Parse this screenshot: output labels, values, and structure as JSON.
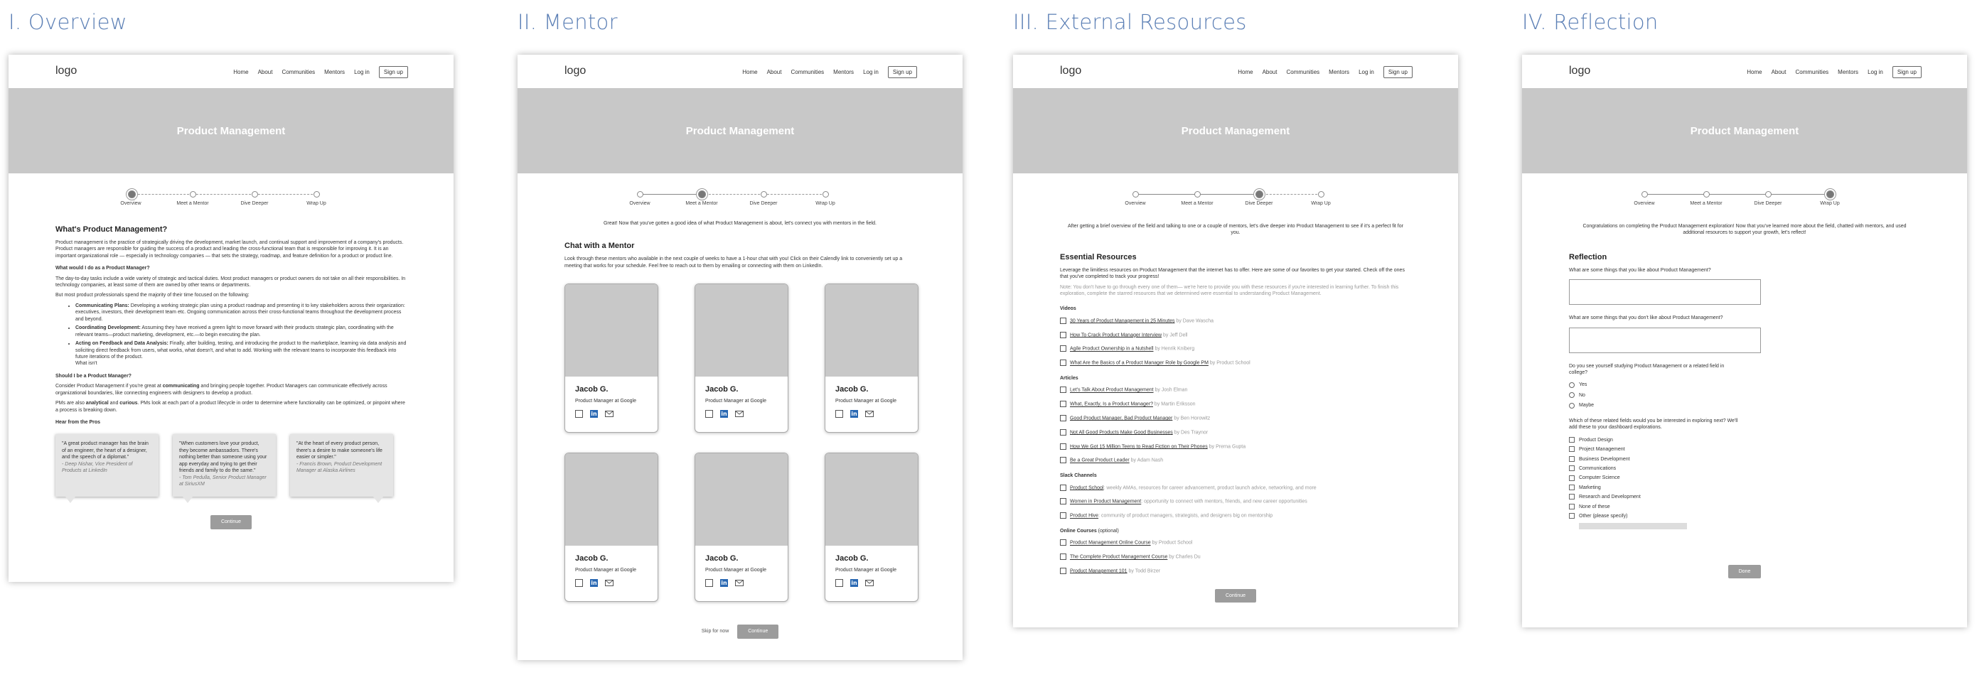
{
  "nav": {
    "logo": "logo",
    "items": [
      "Home",
      "About",
      "Communities",
      "Mentors",
      "Log in"
    ],
    "signup": "Sign up"
  },
  "hero_title": "Product Management",
  "steps": [
    "Overview",
    "Meet a Mentor",
    "Dive Deeper",
    "Wrap Up"
  ],
  "overview": {
    "title": "I. Overview",
    "heading": "What's Product Management?",
    "intro": "Product management is the practice of strategically driving the development, market launch, and continual support and improvement of a company's products. Product managers are responsible for guiding the success of a product and leading the cross-functional team that is responsible for improving it. It is an important organizational role — especially in technology companies — that sets the strategy, roadmap, and feature definition for a product or product line.",
    "q1": "What would I do as a Product Manager?",
    "p1": "The day-to-day tasks include a wide variety of strategic and tactical duties. Most product managers or product owners do not take on all their responsibilities. In technology companies, at least some of them are owned by other teams or departments.",
    "p2": "But most product professionals spend the majority of their time focused on the following:",
    "bullets": [
      {
        "b": "Communicating Plans:",
        "t": " Developing a working strategic plan using a product roadmap and presenting it to key stakeholders across their organization: executives, investors, their development team etc. Ongoing communication across their cross-functional teams throughout the development process and beyond."
      },
      {
        "b": "Coordinating Development:",
        "t": " Assuming they have received a green light to move forward with their products strategic plan, coordinating with the relevant teams—product marketing, development, etc.—to begin executing the plan."
      },
      {
        "b": "Acting on Feedback and Data Analysis:",
        "t": " Finally, after building, testing, and introducing the product to the marketplace, learning via data analysis and soliciting direct feedback from users, what works, what doesn't, and what to add. Working with the relevant teams to incorporate this feedback into future iterations of the product."
      }
    ],
    "whatisnt": "What isn't",
    "q2": "Should I be a Product Manager?",
    "p3a": "Consider Product Management if you're great at ",
    "p3b": "communicating",
    "p3c": " and bringing people together. Product Managers can communicate effectively across organizational boundaries, like connecting engineers with designers to develop a product.",
    "p4a": "PMs are also ",
    "p4b": "analytical",
    "p4c": " and ",
    "p4d": "curious",
    "p4e": ". PMs look at each part of a product lifecycle in order to determine where functionality can be optimized, or pinpoint where a process is breaking down.",
    "q3": "Hear from the Pros",
    "quotes": [
      {
        "q": "\"A great product manager has the brain of an engineer, the heart of a designer, and the speech of a diplomat.\"",
        "s": "- Deep Nishar, Vice President of Products at LinkedIn"
      },
      {
        "q": "\"When customers love your product, they become ambassadors. There's nothing better than someone using your app everyday and trying to get their friends and family to do the same.\"",
        "s": "- Tom Pedulla, Senior Product Manager at SiriusXM"
      },
      {
        "q": "\"At the heart of every product person, there's a desire to make someone's life easier or simpler.\"",
        "s": "- Francis Brown, Product Development Manager at Alaska Airlines"
      }
    ],
    "button": "Continue"
  },
  "mentor": {
    "title": "II. Mentor",
    "intro": "Great! Now that you've gotten a good idea of what Product Management is about, let's connect you with mentors in the field.",
    "heading": "Chat with a Mentor",
    "desc": "Look through these mentors who available in the next couple of weeks to have a 1-hour chat with you! Click on their Calendly link to conveniently set up a meeting that works for your schedule. Feel free to reach out to them by emailing or connecting with them on LinkedIn.",
    "cards": [
      {
        "name": "Jacob G.",
        "role": "Product Manager at Google"
      },
      {
        "name": "Jacob G.",
        "role": "Product Manager at Google"
      },
      {
        "name": "Jacob G.",
        "role": "Product Manager at Google"
      },
      {
        "name": "Jacob G.",
        "role": "Product Manager at Google"
      },
      {
        "name": "Jacob G.",
        "role": "Product Manager at Google"
      },
      {
        "name": "Jacob G.",
        "role": "Product Manager at Google"
      }
    ],
    "linkedin_glyph": "in",
    "skip": "Skip for now",
    "button": "Continue"
  },
  "resources": {
    "title": "III. External Resources",
    "intro": "After getting a brief overview of the field and talking to one or a couple of mentors, let's dive deeper into Product Management to see if it's a perfect fit for you.",
    "heading": "Essential Resources",
    "desc": "Leverage the limitless resources on Product Management that the internet has to offer. Here are some of our favorites to get your started. Check off the ones that you've completed to track your progress!",
    "note": "Note: You don't have to go through every one of them— we're here to provide you with these resources if you're interested in learning further. To finish this exploration, complete the starred resources that we determined were essential to understanding Product Management.",
    "groups": [
      {
        "title": "Videos",
        "opt": "",
        "items": [
          {
            "t": "30 Years of Product Management in 25 Minutes",
            "b": " by Dave Wascha"
          },
          {
            "t": "How To Crack Product Manager Interview",
            "b": " by Jeff Dell"
          },
          {
            "t": "Agile Product Ownership in a Nutshell",
            "b": " by Henrik Kniberg"
          },
          {
            "t": "What Are the Basics of a Product Manager Role by Google PM",
            "b": " by Product School"
          }
        ]
      },
      {
        "title": "Articles",
        "opt": "",
        "items": [
          {
            "t": "Let's Talk About Product Management",
            "b": " by Josh Elman"
          },
          {
            "t": "What, Exactly, Is a Product Manager?",
            "b": " by Martin Eriksson"
          },
          {
            "t": "Good Product Manager, Bad Product Manager",
            "b": " by Ben Horowitz"
          },
          {
            "t": "Not All Good Products Make Good Businesses",
            "b": " by Des Traynor"
          },
          {
            "t": "How We Got 15 Million Teens to Read Fiction on Their Phones",
            "b": " by Prerna Gupta"
          },
          {
            "t": "Be a Great Product Leader",
            "b": " by Adam Nash"
          }
        ]
      },
      {
        "title": "Slack Channels",
        "opt": "",
        "items": [
          {
            "t": "Product School",
            "b": ": weekly AMAs, resources for career advancement, product launch advice, networking, and more"
          },
          {
            "t": "Women in Product Management",
            "b": ": opportunity to connect with mentors, friends, and new career opportunities"
          },
          {
            "t": "Product Hive",
            "b": ": community of product managers, strategists, and designers big on mentorship"
          }
        ]
      },
      {
        "title": "Online Courses",
        "opt": " (optional)",
        "items": [
          {
            "t": "Product Management Online Course",
            "b": " by Product School"
          },
          {
            "t": "The Complete Product Management Course",
            "b": " by Charles Du"
          },
          {
            "t": "Product Management 101",
            "b": " by Todd Birzer"
          }
        ]
      }
    ],
    "button": "Continue"
  },
  "reflection": {
    "title": "IV. Reflection",
    "intro": "Congratulations on completing the Product Management exploration! Now that you've learned more about the field, chatted with mentors, and used additional resources to support your growth, let's reflect!",
    "heading": "Reflection",
    "q1": "What are some things that you like about Product Management?",
    "q2": "What are some things that you don't like about Product Management?",
    "q3": "Do you see yourself studying Product Management or a related field in college?",
    "radios": [
      "Yes",
      "No",
      "Maybe"
    ],
    "q4": "Which of these related fields would you be interested in exploring next? We'll add these to your dashboard explorations.",
    "fields": [
      "Product Design",
      "Project Management",
      "Business Development",
      "Communications",
      "Computer Science",
      "Marketing",
      "Research and Development",
      "None of these",
      "Other (please specify)"
    ],
    "button": "Done"
  }
}
